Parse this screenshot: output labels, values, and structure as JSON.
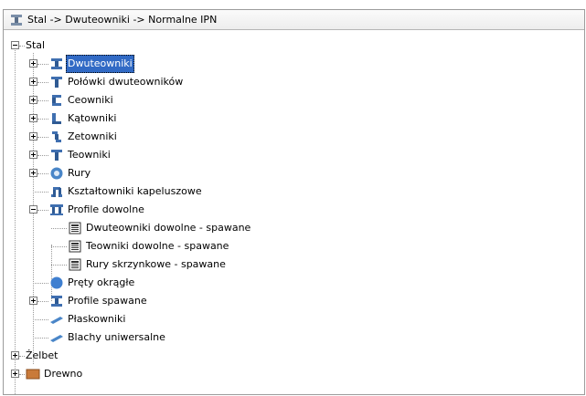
{
  "header": {
    "path": "Stal -> Dwuteowniki -> Normalne IPN"
  },
  "tree": {
    "root": "Stal",
    "items": [
      {
        "label": "Dwuteowniki"
      },
      {
        "label": "Połówki dwuteowników"
      },
      {
        "label": "Ceowniki"
      },
      {
        "label": "Kątowniki"
      },
      {
        "label": "Zetowniki"
      },
      {
        "label": "Teowniki"
      },
      {
        "label": "Rury"
      },
      {
        "label": "Kształtowniki kapeluszowe"
      },
      {
        "label": "Profile dowolne"
      },
      {
        "label": "Dwuteowniki dowolne - spawane"
      },
      {
        "label": "Teowniki dowolne - spawane"
      },
      {
        "label": "Rury skrzynkowe - spawane"
      },
      {
        "label": "Pręty okrągłe"
      },
      {
        "label": "Profile spawane"
      },
      {
        "label": "Płaskowniki"
      },
      {
        "label": "Blachy uniwersalne"
      },
      {
        "label": "Żelbet"
      },
      {
        "label": "Drewno"
      }
    ]
  },
  "colors": {
    "selection": "#316ac5",
    "steel": "#3f6fb0",
    "wood": "#c97a3a"
  }
}
